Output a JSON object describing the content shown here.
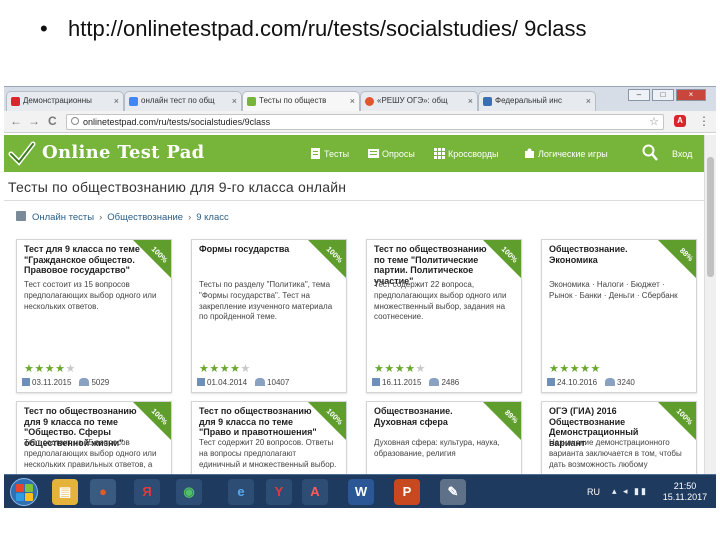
{
  "slide": {
    "bullet": "•",
    "url_text": "http://onlinetestpad.com/ru/tests/socialstudies/ 9class"
  },
  "browser": {
    "tabs": [
      {
        "label": "Демонстрационны",
        "color": "#d9262c",
        "active": false
      },
      {
        "label": "онлайн тест по общ",
        "color": "#4285f4",
        "active": false
      },
      {
        "label": "Тесты по обществ",
        "color": "#76b53a",
        "active": true
      },
      {
        "label": "«РЕШУ ОГЭ»: общ",
        "color": "#e0572e",
        "active": false
      },
      {
        "label": "Федеральный инс",
        "color": "#3a6fb5",
        "active": false
      }
    ],
    "tab_close": "×",
    "window_controls": {
      "min": "–",
      "max": "□",
      "close": "×"
    },
    "nav": {
      "back": "←",
      "forward": "→",
      "reload": "C"
    },
    "address": "onlinetestpad.com/ru/tests/socialstudies/9class",
    "star": "☆",
    "ext_label": "A",
    "menu": "⋮"
  },
  "site": {
    "logo_text": "Online Test Pad",
    "brand_color": "#76b53a",
    "nav": [
      {
        "label": "Тесты",
        "icon": "document-icon"
      },
      {
        "label": "Опросы",
        "icon": "survey-icon"
      },
      {
        "label": "Кроссворды",
        "icon": "grid-icon"
      },
      {
        "label": "Логические игры",
        "icon": "puzzle-icon"
      }
    ],
    "login": "Вход"
  },
  "page": {
    "title": "Тесты по обществознанию для 9-го класса онлайн",
    "breadcrumb": [
      "Онлайн тесты",
      "Обществознание",
      "9 класс"
    ],
    "breadcrumb_sep": "›"
  },
  "cards": [
    {
      "title": "Тест для 9 класса по теме \"Гражданское общество. Правовое государство\"",
      "badge": "100%",
      "desc": "Тест состоит из 15 вопросов предполагающих выбор одного или нескольких ответов.",
      "rating": 4,
      "date": "03.11.2015",
      "count": "5029"
    },
    {
      "title": "Формы государства",
      "badge": "100%",
      "desc": "Тесты по разделу \"Политика\", тема \"Формы государства\". Тест на закрепление изученного материала по пройденной теме.",
      "rating": 4,
      "date": "01.04.2014",
      "count": "10407"
    },
    {
      "title": "Тест по обществознанию по теме \"Политические партии. Политическое участие\"",
      "badge": "100%",
      "desc": "Тест содержит 22 вопроса, предполагающих выбор одного или множественный выбор, задания на соотнесение.",
      "rating": 4,
      "date": "16.11.2015",
      "count": "2486"
    },
    {
      "title": "Обществознание. Экономика",
      "badge": "88%",
      "desc": "Экономика · Налоги · Бюджет · Рынок · Банки · Деньги · Сбербанк",
      "rating": 5,
      "date": "24.10.2016",
      "count": "3240"
    },
    {
      "title": "Тест по обществознанию для 9 класса по теме \"Общество. Сферы общественной жизни\"",
      "badge": "100%",
      "desc": "Тест состоит из 15 вопросов предполагающих выбор одного или нескольких правильных ответов, а",
      "rating": 0,
      "date": "",
      "count": ""
    },
    {
      "title": "Тест по обществознанию для 9 класса по теме \"Право и правотношения\"",
      "badge": "100%",
      "desc": "Тест содержит 20 вопросов. Ответы на вопросы предполагают единичный и множественный выбор.",
      "rating": 0,
      "date": "",
      "count": ""
    },
    {
      "title": "Обществознание. Духовная сфера",
      "badge": "89%",
      "desc": "Духовная сфера: культура, наука, образование, религия",
      "rating": 0,
      "date": "",
      "count": ""
    },
    {
      "title": "ОГЭ (ГИА) 2016 Обществознание Демонстрационный вариант",
      "badge": "100%",
      "desc": "Назначение демонстрационного варианта заключается в том, чтобы дать возможность любому",
      "rating": 0,
      "date": "",
      "count": ""
    }
  ],
  "taskbar": {
    "apps": [
      {
        "name": "explorer",
        "label": "▤",
        "color": "#e5b33b"
      },
      {
        "name": "media",
        "label": "●",
        "color": "#e25b2a"
      },
      {
        "name": "yandex-browser",
        "label": "Я",
        "color": "#d42b2b"
      },
      {
        "name": "chrome",
        "label": "◉",
        "color": "#3aa34a"
      },
      {
        "name": "internet-explorer",
        "label": "e",
        "color": "#2c7fd6"
      },
      {
        "name": "yandex",
        "label": "Y",
        "color": "#e8e8e8"
      },
      {
        "name": "acrobat",
        "label": "A",
        "color": "#b51d1d"
      },
      {
        "name": "word",
        "label": "W",
        "color": "#2b5797"
      },
      {
        "name": "powerpoint",
        "label": "P",
        "color": "#c8491f"
      },
      {
        "name": "paint",
        "label": "✎",
        "color": "#8c9bab"
      }
    ],
    "lang": "RU",
    "tray": "▴ ◂ ▮▮",
    "time": "21:50",
    "date": "15.11.2017"
  }
}
